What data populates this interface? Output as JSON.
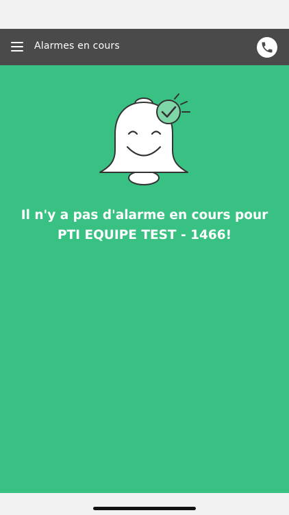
{
  "header": {
    "title": "Alarmes en cours",
    "menu_icon": "hamburger-menu-icon",
    "call_icon": "phone-icon"
  },
  "main": {
    "illustration_icon": "smiling-bell-check-icon",
    "message_line1": "Il n'y a pas d'alarme en cours pour",
    "message_line2": "PTI EQUIPE TEST - 1466!"
  },
  "colors": {
    "app_bar": "#4a4a4a",
    "background": "#38c183",
    "check_badge": "#7fd6a6"
  }
}
